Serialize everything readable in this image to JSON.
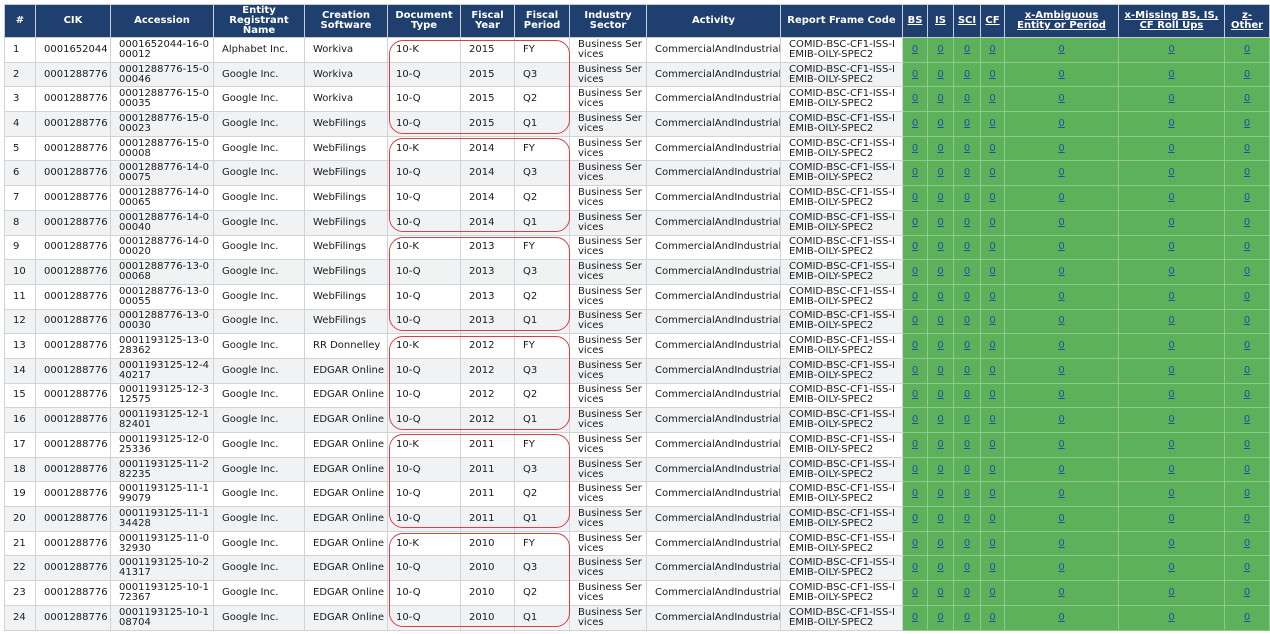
{
  "headers": {
    "idx": "#",
    "cik": "CIK",
    "accession": "Accession",
    "entity": "Entity Registrant Name",
    "software": "Creation Software",
    "doctype": "Document Type",
    "fy": "Fiscal Year",
    "fp": "Fiscal Period",
    "sector": "Industry Sector",
    "activity": "Activity",
    "frame": "Report Frame Code",
    "bs": "BS",
    "is": "IS",
    "sci": "SCI",
    "cf": "CF",
    "x_amb": "x-Ambiguous Entity or Period",
    "x_missing": "x-Missing BS, IS, CF Roll Ups",
    "z_other": "z-Other"
  },
  "rows": [
    {
      "n": "1",
      "cik": "0001652044",
      "acc": "0001652044-16-000012",
      "entity": "Alphabet Inc.",
      "sw": "Workiva",
      "doc": "10-K",
      "fy": "2015",
      "fp": "FY",
      "sector": "Business Services",
      "activity": "CommercialAndIndustrial",
      "frame": "COMID-BSC-CF1-ISS-IEMIB-OILY-SPEC2",
      "bs": "0",
      "is": "0",
      "sci": "0",
      "cf": "0",
      "xa": "0",
      "xm": "0",
      "zo": "0"
    },
    {
      "n": "2",
      "cik": "0001288776",
      "acc": "0001288776-15-000046",
      "entity": "Google Inc.",
      "sw": "Workiva",
      "doc": "10-Q",
      "fy": "2015",
      "fp": "Q3",
      "sector": "Business Services",
      "activity": "CommercialAndIndustrial",
      "frame": "COMID-BSC-CF1-ISS-IEMIB-OILY-SPEC2",
      "bs": "0",
      "is": "0",
      "sci": "0",
      "cf": "0",
      "xa": "0",
      "xm": "0",
      "zo": "0"
    },
    {
      "n": "3",
      "cik": "0001288776",
      "acc": "0001288776-15-000035",
      "entity": "Google Inc.",
      "sw": "Workiva",
      "doc": "10-Q",
      "fy": "2015",
      "fp": "Q2",
      "sector": "Business Services",
      "activity": "CommercialAndIndustrial",
      "frame": "COMID-BSC-CF1-ISS-IEMIB-OILY-SPEC2",
      "bs": "0",
      "is": "0",
      "sci": "0",
      "cf": "0",
      "xa": "0",
      "xm": "0",
      "zo": "0"
    },
    {
      "n": "4",
      "cik": "0001288776",
      "acc": "0001288776-15-000023",
      "entity": "Google Inc.",
      "sw": "WebFilings",
      "doc": "10-Q",
      "fy": "2015",
      "fp": "Q1",
      "sector": "Business Services",
      "activity": "CommercialAndIndustrial",
      "frame": "COMID-BSC-CF1-ISS-IEMIB-OILY-SPEC2",
      "bs": "0",
      "is": "0",
      "sci": "0",
      "cf": "0",
      "xa": "0",
      "xm": "0",
      "zo": "0"
    },
    {
      "n": "5",
      "cik": "0001288776",
      "acc": "0001288776-15-000008",
      "entity": "Google Inc.",
      "sw": "WebFilings",
      "doc": "10-K",
      "fy": "2014",
      "fp": "FY",
      "sector": "Business Services",
      "activity": "CommercialAndIndustrial",
      "frame": "COMID-BSC-CF1-ISS-IEMIB-OILY-SPEC2",
      "bs": "0",
      "is": "0",
      "sci": "0",
      "cf": "0",
      "xa": "0",
      "xm": "0",
      "zo": "0"
    },
    {
      "n": "6",
      "cik": "0001288776",
      "acc": "0001288776-14-000075",
      "entity": "Google Inc.",
      "sw": "WebFilings",
      "doc": "10-Q",
      "fy": "2014",
      "fp": "Q3",
      "sector": "Business Services",
      "activity": "CommercialAndIndustrial",
      "frame": "COMID-BSC-CF1-ISS-IEMIB-OILY-SPEC2",
      "bs": "0",
      "is": "0",
      "sci": "0",
      "cf": "0",
      "xa": "0",
      "xm": "0",
      "zo": "0"
    },
    {
      "n": "7",
      "cik": "0001288776",
      "acc": "0001288776-14-000065",
      "entity": "Google Inc.",
      "sw": "WebFilings",
      "doc": "10-Q",
      "fy": "2014",
      "fp": "Q2",
      "sector": "Business Services",
      "activity": "CommercialAndIndustrial",
      "frame": "COMID-BSC-CF1-ISS-IEMIB-OILY-SPEC2",
      "bs": "0",
      "is": "0",
      "sci": "0",
      "cf": "0",
      "xa": "0",
      "xm": "0",
      "zo": "0"
    },
    {
      "n": "8",
      "cik": "0001288776",
      "acc": "0001288776-14-000040",
      "entity": "Google Inc.",
      "sw": "WebFilings",
      "doc": "10-Q",
      "fy": "2014",
      "fp": "Q1",
      "sector": "Business Services",
      "activity": "CommercialAndIndustrial",
      "frame": "COMID-BSC-CF1-ISS-IEMIB-OILY-SPEC2",
      "bs": "0",
      "is": "0",
      "sci": "0",
      "cf": "0",
      "xa": "0",
      "xm": "0",
      "zo": "0"
    },
    {
      "n": "9",
      "cik": "0001288776",
      "acc": "0001288776-14-000020",
      "entity": "Google Inc.",
      "sw": "WebFilings",
      "doc": "10-K",
      "fy": "2013",
      "fp": "FY",
      "sector": "Business Services",
      "activity": "CommercialAndIndustrial",
      "frame": "COMID-BSC-CF1-ISS-IEMIB-OILY-SPEC2",
      "bs": "0",
      "is": "0",
      "sci": "0",
      "cf": "0",
      "xa": "0",
      "xm": "0",
      "zo": "0"
    },
    {
      "n": "10",
      "cik": "0001288776",
      "acc": "0001288776-13-000068",
      "entity": "Google Inc.",
      "sw": "WebFilings",
      "doc": "10-Q",
      "fy": "2013",
      "fp": "Q3",
      "sector": "Business Services",
      "activity": "CommercialAndIndustrial",
      "frame": "COMID-BSC-CF1-ISS-IEMIB-OILY-SPEC2",
      "bs": "0",
      "is": "0",
      "sci": "0",
      "cf": "0",
      "xa": "0",
      "xm": "0",
      "zo": "0"
    },
    {
      "n": "11",
      "cik": "0001288776",
      "acc": "0001288776-13-000055",
      "entity": "Google Inc.",
      "sw": "WebFilings",
      "doc": "10-Q",
      "fy": "2013",
      "fp": "Q2",
      "sector": "Business Services",
      "activity": "CommercialAndIndustrial",
      "frame": "COMID-BSC-CF1-ISS-IEMIB-OILY-SPEC2",
      "bs": "0",
      "is": "0",
      "sci": "0",
      "cf": "0",
      "xa": "0",
      "xm": "0",
      "zo": "0"
    },
    {
      "n": "12",
      "cik": "0001288776",
      "acc": "0001288776-13-000030",
      "entity": "Google Inc.",
      "sw": "WebFilings",
      "doc": "10-Q",
      "fy": "2013",
      "fp": "Q1",
      "sector": "Business Services",
      "activity": "CommercialAndIndustrial",
      "frame": "COMID-BSC-CF1-ISS-IEMIB-OILY-SPEC2",
      "bs": "0",
      "is": "0",
      "sci": "0",
      "cf": "0",
      "xa": "0",
      "xm": "0",
      "zo": "0"
    },
    {
      "n": "13",
      "cik": "0001288776",
      "acc": "0001193125-13-028362",
      "entity": "Google Inc.",
      "sw": "RR Donnelley",
      "doc": "10-K",
      "fy": "2012",
      "fp": "FY",
      "sector": "Business Services",
      "activity": "CommercialAndIndustrial",
      "frame": "COMID-BSC-CF1-ISS-IEMIB-OILY-SPEC2",
      "bs": "0",
      "is": "0",
      "sci": "0",
      "cf": "0",
      "xa": "0",
      "xm": "0",
      "zo": "0"
    },
    {
      "n": "14",
      "cik": "0001288776",
      "acc": "0001193125-12-440217",
      "entity": "Google Inc.",
      "sw": "EDGAR Online",
      "doc": "10-Q",
      "fy": "2012",
      "fp": "Q3",
      "sector": "Business Services",
      "activity": "CommercialAndIndustrial",
      "frame": "COMID-BSC-CF1-ISS-IEMIB-OILY-SPEC2",
      "bs": "0",
      "is": "0",
      "sci": "0",
      "cf": "0",
      "xa": "0",
      "xm": "0",
      "zo": "0"
    },
    {
      "n": "15",
      "cik": "0001288776",
      "acc": "0001193125-12-312575",
      "entity": "Google Inc.",
      "sw": "EDGAR Online",
      "doc": "10-Q",
      "fy": "2012",
      "fp": "Q2",
      "sector": "Business Services",
      "activity": "CommercialAndIndustrial",
      "frame": "COMID-BSC-CF1-ISS-IEMIB-OILY-SPEC2",
      "bs": "0",
      "is": "0",
      "sci": "0",
      "cf": "0",
      "xa": "0",
      "xm": "0",
      "zo": "0"
    },
    {
      "n": "16",
      "cik": "0001288776",
      "acc": "0001193125-12-182401",
      "entity": "Google Inc.",
      "sw": "EDGAR Online",
      "doc": "10-Q",
      "fy": "2012",
      "fp": "Q1",
      "sector": "Business Services",
      "activity": "CommercialAndIndustrial",
      "frame": "COMID-BSC-CF1-ISS-IEMIB-OILY-SPEC2",
      "bs": "0",
      "is": "0",
      "sci": "0",
      "cf": "0",
      "xa": "0",
      "xm": "0",
      "zo": "0"
    },
    {
      "n": "17",
      "cik": "0001288776",
      "acc": "0001193125-12-025336",
      "entity": "Google Inc.",
      "sw": "EDGAR Online",
      "doc": "10-K",
      "fy": "2011",
      "fp": "FY",
      "sector": "Business Services",
      "activity": "CommercialAndIndustrial",
      "frame": "COMID-BSC-CF1-ISS-IEMIB-OILY-SPEC2",
      "bs": "0",
      "is": "0",
      "sci": "0",
      "cf": "0",
      "xa": "0",
      "xm": "0",
      "zo": "0"
    },
    {
      "n": "18",
      "cik": "0001288776",
      "acc": "0001193125-11-282235",
      "entity": "Google Inc.",
      "sw": "EDGAR Online",
      "doc": "10-Q",
      "fy": "2011",
      "fp": "Q3",
      "sector": "Business Services",
      "activity": "CommercialAndIndustrial",
      "frame": "COMID-BSC-CF1-ISS-IEMIB-OILY-SPEC2",
      "bs": "0",
      "is": "0",
      "sci": "0",
      "cf": "0",
      "xa": "0",
      "xm": "0",
      "zo": "0"
    },
    {
      "n": "19",
      "cik": "0001288776",
      "acc": "0001193125-11-199079",
      "entity": "Google Inc.",
      "sw": "EDGAR Online",
      "doc": "10-Q",
      "fy": "2011",
      "fp": "Q2",
      "sector": "Business Services",
      "activity": "CommercialAndIndustrial",
      "frame": "COMID-BSC-CF1-ISS-IEMIB-OILY-SPEC2",
      "bs": "0",
      "is": "0",
      "sci": "0",
      "cf": "0",
      "xa": "0",
      "xm": "0",
      "zo": "0"
    },
    {
      "n": "20",
      "cik": "0001288776",
      "acc": "0001193125-11-134428",
      "entity": "Google Inc.",
      "sw": "EDGAR Online",
      "doc": "10-Q",
      "fy": "2011",
      "fp": "Q1",
      "sector": "Business Services",
      "activity": "CommercialAndIndustrial",
      "frame": "COMID-BSC-CF1-ISS-IEMIB-OILY-SPEC2",
      "bs": "0",
      "is": "0",
      "sci": "0",
      "cf": "0",
      "xa": "0",
      "xm": "0",
      "zo": "0"
    },
    {
      "n": "21",
      "cik": "0001288776",
      "acc": "0001193125-11-032930",
      "entity": "Google Inc.",
      "sw": "EDGAR Online",
      "doc": "10-K",
      "fy": "2010",
      "fp": "FY",
      "sector": "Business Services",
      "activity": "CommercialAndIndustrial",
      "frame": "COMID-BSC-CF1-ISS-IEMIB-OILY-SPEC2",
      "bs": "0",
      "is": "0",
      "sci": "0",
      "cf": "0",
      "xa": "0",
      "xm": "0",
      "zo": "0"
    },
    {
      "n": "22",
      "cik": "0001288776",
      "acc": "0001193125-10-241317",
      "entity": "Google Inc.",
      "sw": "EDGAR Online",
      "doc": "10-Q",
      "fy": "2010",
      "fp": "Q3",
      "sector": "Business Services",
      "activity": "CommercialAndIndustrial",
      "frame": "COMID-BSC-CF1-ISS-IEMIB-OILY-SPEC2",
      "bs": "0",
      "is": "0",
      "sci": "0",
      "cf": "0",
      "xa": "0",
      "xm": "0",
      "zo": "0"
    },
    {
      "n": "23",
      "cik": "0001288776",
      "acc": "0001193125-10-172367",
      "entity": "Google Inc.",
      "sw": "EDGAR Online",
      "doc": "10-Q",
      "fy": "2010",
      "fp": "Q2",
      "sector": "Business Services",
      "activity": "CommercialAndIndustrial",
      "frame": "COMID-BSC-CF1-ISS-IEMIB-OILY-SPEC2",
      "bs": "0",
      "is": "0",
      "sci": "0",
      "cf": "0",
      "xa": "0",
      "xm": "0",
      "zo": "0"
    },
    {
      "n": "24",
      "cik": "0001288776",
      "acc": "0001193125-10-108704",
      "entity": "Google Inc.",
      "sw": "EDGAR Online",
      "doc": "10-Q",
      "fy": "2010",
      "fp": "Q1",
      "sector": "Business Services",
      "activity": "CommercialAndIndustrial",
      "frame": "COMID-BSC-CF1-ISS-IEMIB-OILY-SPEC2",
      "bs": "0",
      "is": "0",
      "sci": "0",
      "cf": "0",
      "xa": "0",
      "xm": "0",
      "zo": "0"
    }
  ],
  "colors": {
    "header_bg": "#1f3f6e",
    "status_green": "#5db15a",
    "link_blue": "#1f4fa8",
    "highlight_red": "#d94141"
  }
}
